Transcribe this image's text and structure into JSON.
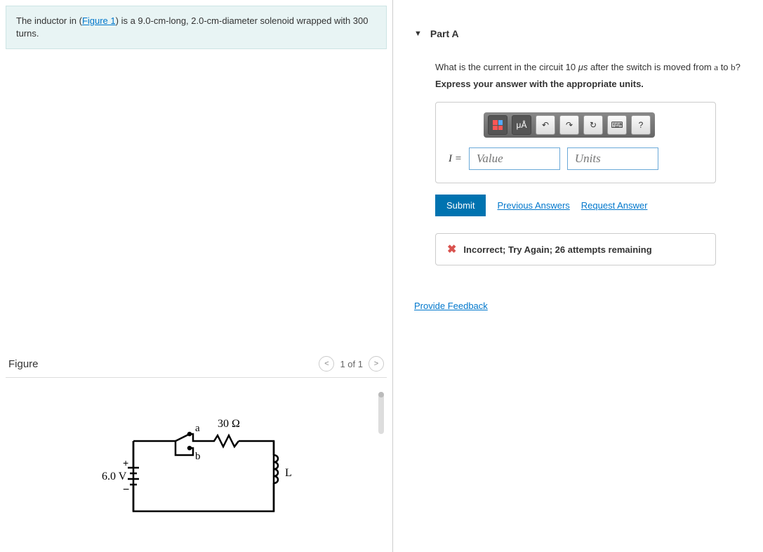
{
  "problem": {
    "prefix": "The inductor in (",
    "figure_link": "Figure 1",
    "suffix": ") is a 9.0-cm-long, 2.0-cm-diameter solenoid wrapped with 300 turns."
  },
  "figure": {
    "title": "Figure",
    "nav_text": "1 of 1",
    "labels": {
      "voltage": "6.0 V",
      "resistor": "30 Ω",
      "inductor": "L",
      "sw_a": "a",
      "sw_b": "b",
      "plus": "+",
      "minus": "−"
    }
  },
  "part": {
    "title": "Part A",
    "question_prefix": "What is the current in the circuit 10 ",
    "question_unit": "μs",
    "question_suffix_1": " after the switch is moved from ",
    "question_a": "a",
    "question_mid": " to ",
    "question_b": "b",
    "question_end": "?",
    "instruction": "Express your answer with the appropriate units.",
    "toolbar": {
      "units_btn": "μÅ",
      "help": "?"
    },
    "answer": {
      "label": "I =",
      "value_placeholder": "Value",
      "units_placeholder": "Units"
    },
    "submit": "Submit",
    "prev_answers": "Previous Answers",
    "request_answer": "Request Answer",
    "feedback": "Incorrect; Try Again; 26 attempts remaining"
  },
  "provide_feedback": "Provide Feedback"
}
